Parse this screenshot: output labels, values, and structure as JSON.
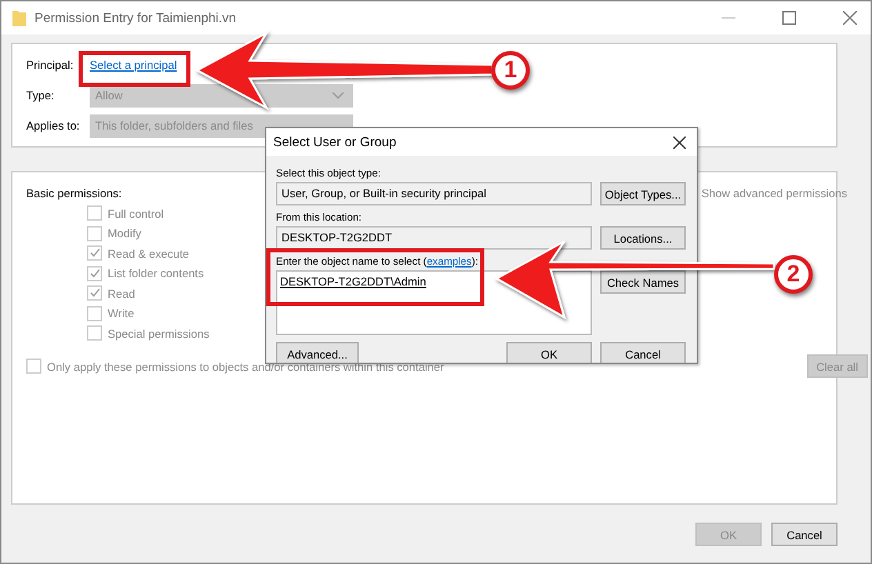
{
  "window": {
    "title": "Permission Entry for Taimienphi.vn"
  },
  "principal": {
    "label": "Principal:",
    "link": "Select a principal"
  },
  "type": {
    "label": "Type:",
    "value": "Allow",
    "disabled": true
  },
  "applies_to": {
    "label": "Applies to:",
    "value": "This folder, subfolders and files",
    "disabled": true
  },
  "basic_permissions": {
    "heading": "Basic permissions:",
    "items": [
      {
        "label": "Full control",
        "checked": false,
        "disabled": true
      },
      {
        "label": "Modify",
        "checked": false,
        "disabled": true
      },
      {
        "label": "Read & execute",
        "checked": true,
        "disabled": true
      },
      {
        "label": "List folder contents",
        "checked": true,
        "disabled": true
      },
      {
        "label": "Read",
        "checked": true,
        "disabled": true
      },
      {
        "label": "Write",
        "checked": false,
        "disabled": true
      },
      {
        "label": "Special permissions",
        "checked": false,
        "disabled": true
      }
    ]
  },
  "show_advanced": "Show advanced permissions",
  "only_apply": {
    "label": "Only apply these permissions to objects and/or containers within this container",
    "checked": false,
    "disabled": true
  },
  "clear_all": {
    "label": "Clear all",
    "disabled": true
  },
  "buttons": [
    {
      "label": "OK",
      "disabled": true
    },
    {
      "label": "Cancel",
      "disabled": false
    }
  ],
  "dialog": {
    "title": "Select User or Group",
    "object_type_label": "Select this object type:",
    "object_type": "User, Group, or Built-in security principal",
    "object_types_button": "Object Types...",
    "location_label": "From this location:",
    "location": "DESKTOP-T2G2DDT",
    "locations_button": "Locations...",
    "name_label_before": "Enter the object name to select (",
    "examples_link": "examples",
    "name_label_after": "):",
    "name_value": "DESKTOP-T2G2DDT\\Admin",
    "check_names_button": "Check Names",
    "advanced_button": "Advanced...",
    "ok_button": "OK",
    "cancel_button": "Cancel"
  },
  "annotations": [
    {
      "number": "1"
    },
    {
      "number": "2"
    }
  ]
}
